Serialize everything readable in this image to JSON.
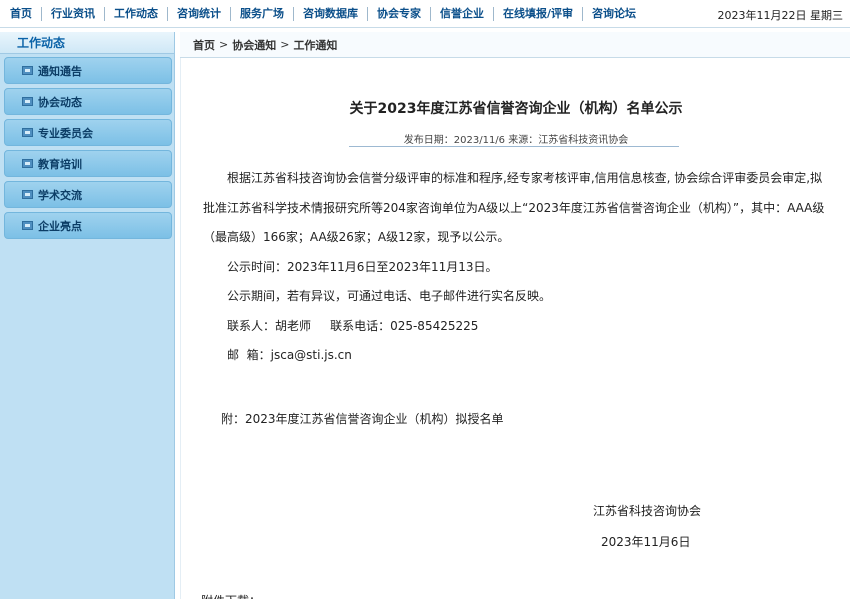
{
  "topnav": {
    "items": [
      "首页",
      "行业资讯",
      "工作动态",
      "咨询统计",
      "服务广场",
      "咨询数据库",
      "协会专家",
      "信誉企业",
      "在线填报/评审",
      "咨询论坛"
    ],
    "date": "2023年11月22日 星期三"
  },
  "sidebar": {
    "title": "工作动态",
    "items": [
      "通知通告",
      "协会动态",
      "专业委员会",
      "教育培训",
      "学术交流",
      "企业亮点"
    ]
  },
  "breadcrumb": {
    "home": "首页",
    "section": "协会通知",
    "current": "工作通知",
    "separator": ">"
  },
  "article": {
    "title": "关于2023年度江苏省信誉咨询企业（机构）名单公示",
    "meta": "发布日期：2023/11/6 来源：江苏省科技资讯协会",
    "para1": "根据江苏省科技咨询协会信誉分级评审的标准和程序,经专家考核评审,信用信息核查, 协会综合评审委员会审定,拟批准江苏省科学技术情报研究所等204家咨询单位为A级以上“2023年度江苏省信誉咨询企业（机构）”，其中：AAA级（最高级）166家；AA级26家；A级12家，现予以公示。",
    "period": "公示时间：2023年11月6日至2023年11月13日。",
    "objection": "公示期间，若有异议，可通过电话、电子邮件进行实名反映。",
    "contact": "联系人：胡老师     联系电话：025-85425225",
    "email": "邮  箱：jsca@sti.js.cn",
    "attachment": "附：2023年度江苏省信誉咨询企业（机构）拟授名单",
    "signature_org": "江苏省科技咨询协会",
    "signature_date": "2023年11月6日",
    "cut_text": "附件下载："
  }
}
